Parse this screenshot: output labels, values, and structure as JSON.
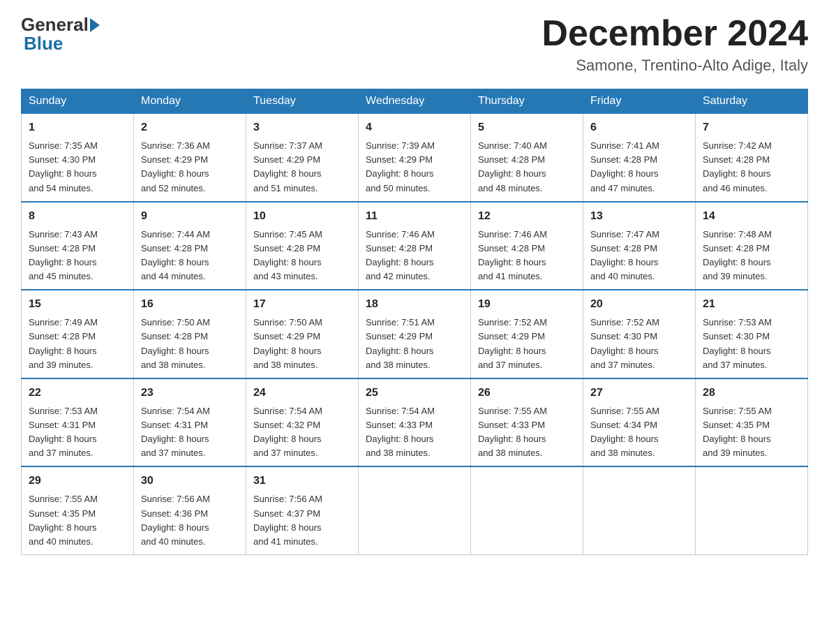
{
  "header": {
    "logo_general": "General",
    "logo_blue": "Blue",
    "month_title": "December 2024",
    "location": "Samone, Trentino-Alto Adige, Italy"
  },
  "days_of_week": [
    "Sunday",
    "Monday",
    "Tuesday",
    "Wednesday",
    "Thursday",
    "Friday",
    "Saturday"
  ],
  "weeks": [
    [
      {
        "day": "1",
        "sunrise": "7:35 AM",
        "sunset": "4:30 PM",
        "daylight": "8 hours and 54 minutes."
      },
      {
        "day": "2",
        "sunrise": "7:36 AM",
        "sunset": "4:29 PM",
        "daylight": "8 hours and 52 minutes."
      },
      {
        "day": "3",
        "sunrise": "7:37 AM",
        "sunset": "4:29 PM",
        "daylight": "8 hours and 51 minutes."
      },
      {
        "day": "4",
        "sunrise": "7:39 AM",
        "sunset": "4:29 PM",
        "daylight": "8 hours and 50 minutes."
      },
      {
        "day": "5",
        "sunrise": "7:40 AM",
        "sunset": "4:28 PM",
        "daylight": "8 hours and 48 minutes."
      },
      {
        "day": "6",
        "sunrise": "7:41 AM",
        "sunset": "4:28 PM",
        "daylight": "8 hours and 47 minutes."
      },
      {
        "day": "7",
        "sunrise": "7:42 AM",
        "sunset": "4:28 PM",
        "daylight": "8 hours and 46 minutes."
      }
    ],
    [
      {
        "day": "8",
        "sunrise": "7:43 AM",
        "sunset": "4:28 PM",
        "daylight": "8 hours and 45 minutes."
      },
      {
        "day": "9",
        "sunrise": "7:44 AM",
        "sunset": "4:28 PM",
        "daylight": "8 hours and 44 minutes."
      },
      {
        "day": "10",
        "sunrise": "7:45 AM",
        "sunset": "4:28 PM",
        "daylight": "8 hours and 43 minutes."
      },
      {
        "day": "11",
        "sunrise": "7:46 AM",
        "sunset": "4:28 PM",
        "daylight": "8 hours and 42 minutes."
      },
      {
        "day": "12",
        "sunrise": "7:46 AM",
        "sunset": "4:28 PM",
        "daylight": "8 hours and 41 minutes."
      },
      {
        "day": "13",
        "sunrise": "7:47 AM",
        "sunset": "4:28 PM",
        "daylight": "8 hours and 40 minutes."
      },
      {
        "day": "14",
        "sunrise": "7:48 AM",
        "sunset": "4:28 PM",
        "daylight": "8 hours and 39 minutes."
      }
    ],
    [
      {
        "day": "15",
        "sunrise": "7:49 AM",
        "sunset": "4:28 PM",
        "daylight": "8 hours and 39 minutes."
      },
      {
        "day": "16",
        "sunrise": "7:50 AM",
        "sunset": "4:28 PM",
        "daylight": "8 hours and 38 minutes."
      },
      {
        "day": "17",
        "sunrise": "7:50 AM",
        "sunset": "4:29 PM",
        "daylight": "8 hours and 38 minutes."
      },
      {
        "day": "18",
        "sunrise": "7:51 AM",
        "sunset": "4:29 PM",
        "daylight": "8 hours and 38 minutes."
      },
      {
        "day": "19",
        "sunrise": "7:52 AM",
        "sunset": "4:29 PM",
        "daylight": "8 hours and 37 minutes."
      },
      {
        "day": "20",
        "sunrise": "7:52 AM",
        "sunset": "4:30 PM",
        "daylight": "8 hours and 37 minutes."
      },
      {
        "day": "21",
        "sunrise": "7:53 AM",
        "sunset": "4:30 PM",
        "daylight": "8 hours and 37 minutes."
      }
    ],
    [
      {
        "day": "22",
        "sunrise": "7:53 AM",
        "sunset": "4:31 PM",
        "daylight": "8 hours and 37 minutes."
      },
      {
        "day": "23",
        "sunrise": "7:54 AM",
        "sunset": "4:31 PM",
        "daylight": "8 hours and 37 minutes."
      },
      {
        "day": "24",
        "sunrise": "7:54 AM",
        "sunset": "4:32 PM",
        "daylight": "8 hours and 37 minutes."
      },
      {
        "day": "25",
        "sunrise": "7:54 AM",
        "sunset": "4:33 PM",
        "daylight": "8 hours and 38 minutes."
      },
      {
        "day": "26",
        "sunrise": "7:55 AM",
        "sunset": "4:33 PM",
        "daylight": "8 hours and 38 minutes."
      },
      {
        "day": "27",
        "sunrise": "7:55 AM",
        "sunset": "4:34 PM",
        "daylight": "8 hours and 38 minutes."
      },
      {
        "day": "28",
        "sunrise": "7:55 AM",
        "sunset": "4:35 PM",
        "daylight": "8 hours and 39 minutes."
      }
    ],
    [
      {
        "day": "29",
        "sunrise": "7:55 AM",
        "sunset": "4:35 PM",
        "daylight": "8 hours and 40 minutes."
      },
      {
        "day": "30",
        "sunrise": "7:56 AM",
        "sunset": "4:36 PM",
        "daylight": "8 hours and 40 minutes."
      },
      {
        "day": "31",
        "sunrise": "7:56 AM",
        "sunset": "4:37 PM",
        "daylight": "8 hours and 41 minutes."
      },
      null,
      null,
      null,
      null
    ]
  ],
  "labels": {
    "sunrise": "Sunrise:",
    "sunset": "Sunset:",
    "daylight": "Daylight:"
  }
}
